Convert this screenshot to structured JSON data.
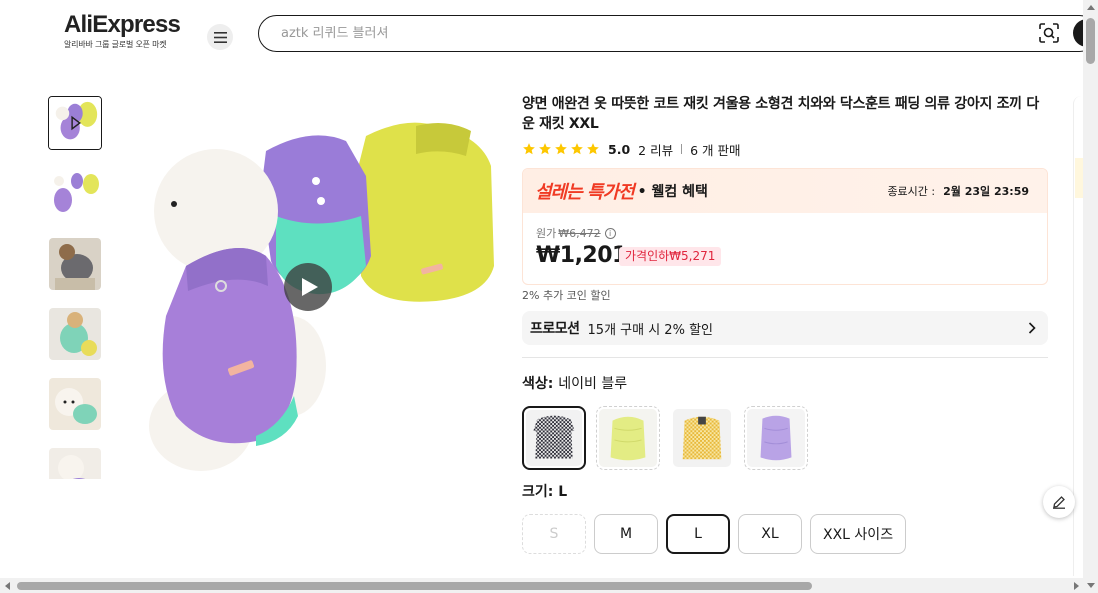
{
  "header": {
    "logo_text": "AliExpress",
    "logo_tagline": "알리바바 그룹 글로벌 오픈 마켓",
    "search_placeholder": "aztk 리퀴드 블러셔"
  },
  "icons": {
    "menu": "hamburger-menu-icon",
    "camera": "camera-search-icon",
    "play": "play-icon",
    "star": "star-icon",
    "info": "info-icon",
    "chevron": "chevron-right-icon",
    "edit": "pencil-edit-icon"
  },
  "colors": {
    "accent": "#e62e04",
    "star": "#fdc700",
    "deal_red": "#f03a24",
    "badge_red": "#e0253d"
  },
  "product": {
    "title": "양면 애완견 옷 따뜻한 코트 재킷 겨울용 소형견 치와와 닥스훈트 패딩 의류 강아지 조끼 다운 재킷 XXL",
    "rating": "5.0",
    "star_count": 5,
    "reviews": "2 리뷰",
    "sold": "6 개 판매"
  },
  "deal": {
    "hot_label": "설레는 특가전",
    "welcome": "• 웰컴 혜택",
    "end_label": "종료시간 :",
    "end_time": "2월 23일 23:59",
    "original_label": "원가",
    "original_price": "₩6,472",
    "info_glyph": "i",
    "price": "₩1,201",
    "discount": "가격인하₩5,271"
  },
  "coin_text": "2% 추가 코인 할인",
  "promo": {
    "tag": "프로모션",
    "text": "15개 구매 시 2% 할인"
  },
  "color": {
    "label": "색상:",
    "selected": "네이비 블루",
    "options": [
      "네이비 블루",
      "옐로우 그린",
      "옐로우 체크",
      "퍼플"
    ]
  },
  "size": {
    "label": "크기:",
    "selected": "L",
    "options": [
      "S",
      "M",
      "L",
      "XL",
      "XXL 사이즈"
    ]
  }
}
